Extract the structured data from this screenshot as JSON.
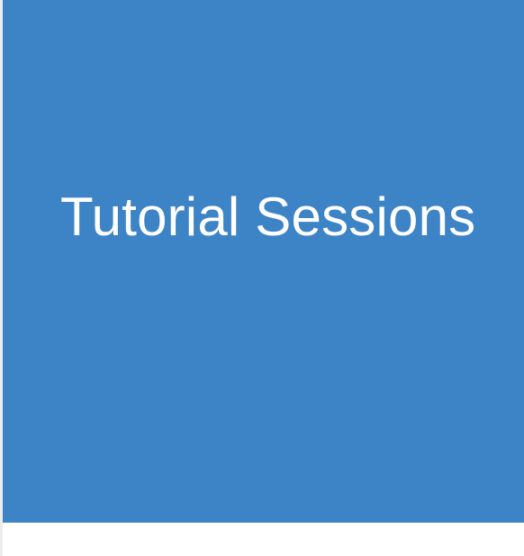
{
  "tile": {
    "title": "Tutorial Sessions",
    "background_color": "#3d84c6",
    "text_color": "#ffffff"
  }
}
